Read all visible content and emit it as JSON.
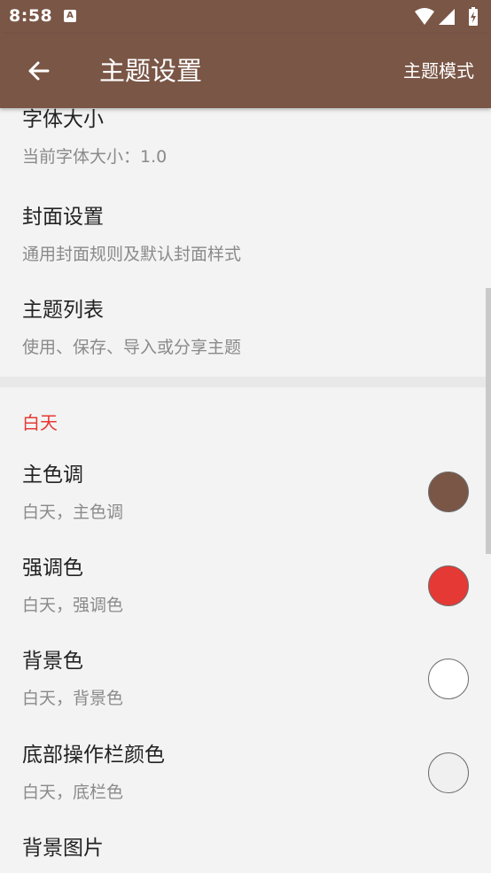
{
  "status_bar": {
    "time": "8:58",
    "notification_icon": "A",
    "icons": [
      "wifi-icon",
      "cellular-signal-icon",
      "battery-charging-icon"
    ]
  },
  "app_bar": {
    "title": "主题设置",
    "action_label": "主题模式",
    "back_icon": "arrow-left-icon",
    "color": "#7a5646"
  },
  "preferences": [
    {
      "title": "字体大小",
      "summary": "当前字体大小：1.0"
    },
    {
      "title": "封面设置",
      "summary": "通用封面规则及默认封面样式"
    },
    {
      "title": "主题列表",
      "summary": "使用、保存、导入或分享主题"
    }
  ],
  "day_section": {
    "header": "白天",
    "header_color": "#e53935",
    "items": [
      {
        "title": "主色调",
        "summary": "白天，主色调",
        "color": "#7a5646"
      },
      {
        "title": "强调色",
        "summary": "白天，强调色",
        "color": "#e53935"
      },
      {
        "title": "背景色",
        "summary": "白天，背景色",
        "color": "#ffffff"
      },
      {
        "title": "底部操作栏颜色",
        "summary": "白天，底栏色",
        "color": "#f0f0f0"
      },
      {
        "title": "背景图片"
      }
    ]
  }
}
